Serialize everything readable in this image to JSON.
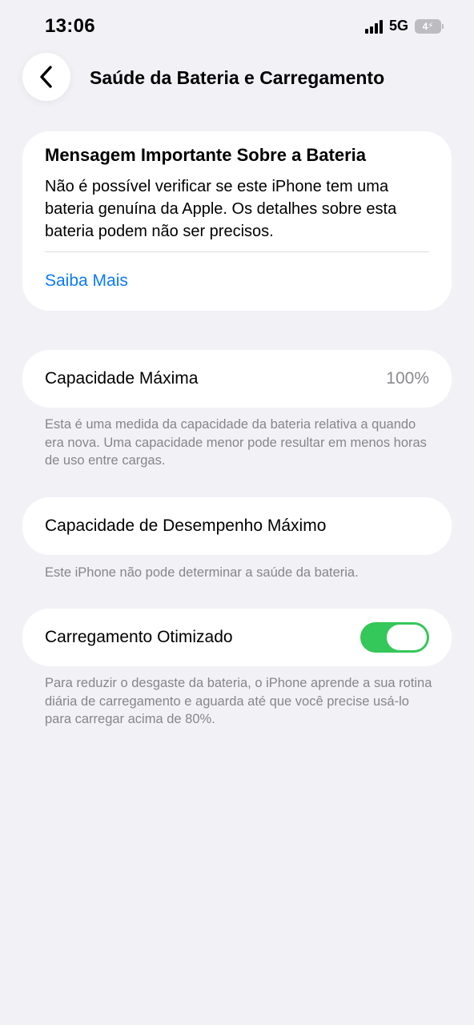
{
  "status_bar": {
    "time": "13:06",
    "network": "5G",
    "battery_label": "4",
    "charging_bolt": "⚡"
  },
  "header": {
    "title": "Saúde da Bateria e Carregamento"
  },
  "message_card": {
    "title": "Mensagem Importante Sobre a Bateria",
    "body": "Não é possível verificar se este iPhone tem uma bateria genuína da Apple. Os detalhes sobre esta bateria podem não ser precisos.",
    "link": "Saiba Mais"
  },
  "max_capacity": {
    "label": "Capacidade Máxima",
    "value": "100%",
    "footnote": "Esta é uma medida da capacidade da bateria relativa a quando era nova. Uma capacidade menor pode resultar em menos horas de uso entre cargas."
  },
  "peak_performance": {
    "label": "Capacidade de Desempenho Máximo",
    "footnote": "Este iPhone não pode determinar a saúde da bateria."
  },
  "optimized_charging": {
    "label": "Carregamento Otimizado",
    "enabled": true,
    "footnote": "Para reduzir o desgaste da bateria, o iPhone aprende a sua rotina diária de carregamento e aguarda até que você precise usá-lo para carregar acima de 80%."
  },
  "colors": {
    "background": "#f2f1f6",
    "link": "#0a7aff",
    "toggle_on": "#34c759",
    "secondary_text": "#86868b"
  },
  "icons": {
    "back": "chevron-left-icon",
    "signal": "cellular-signal-icon",
    "battery": "battery-charging-icon"
  }
}
